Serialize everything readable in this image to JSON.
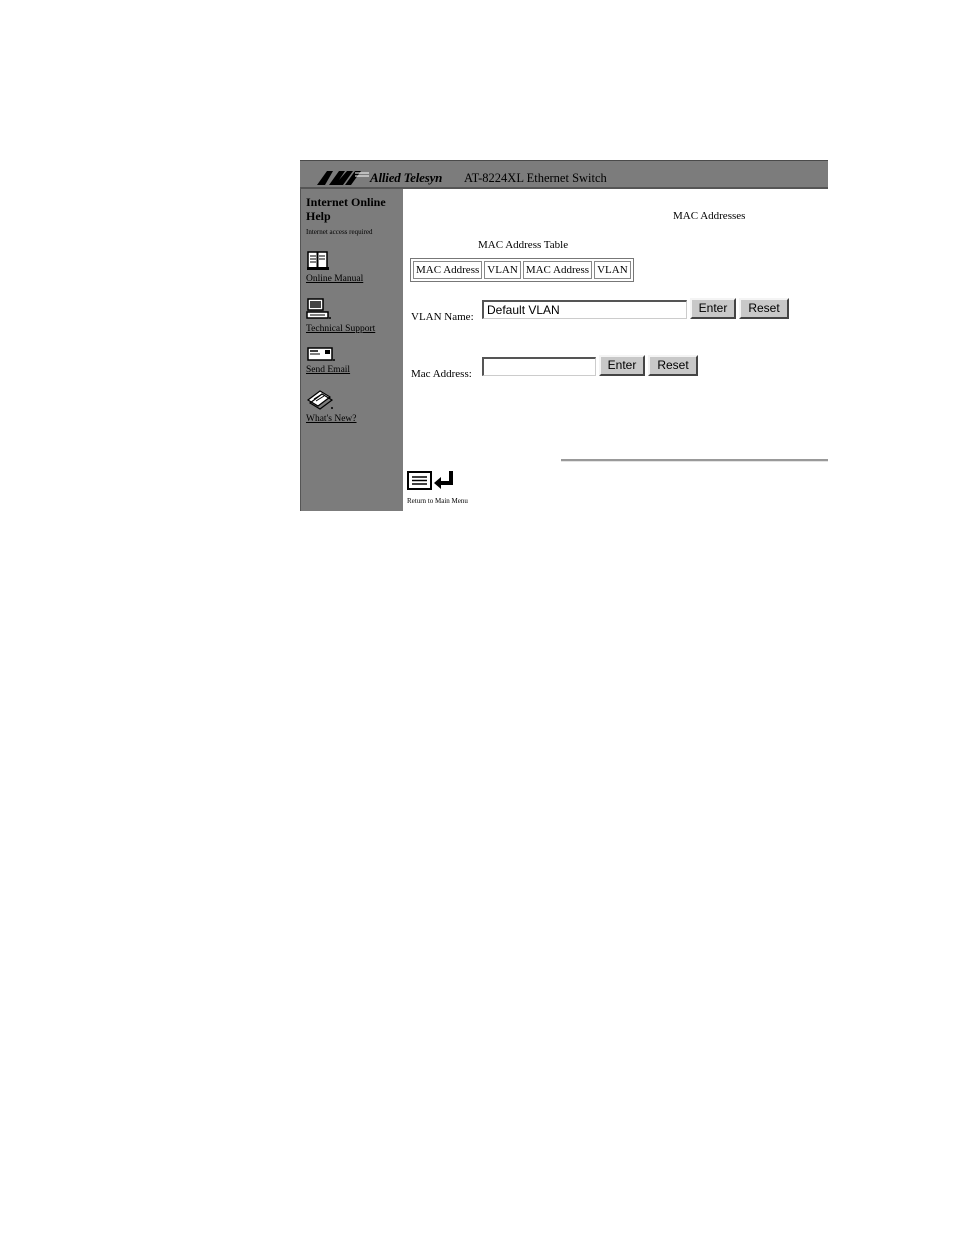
{
  "header": {
    "brand": "Allied Telesyn",
    "product": "AT-8224XL Ethernet Switch"
  },
  "sidebar": {
    "title": "Internet Online Help",
    "note": "Internet access required",
    "links": [
      {
        "label": "Online Manual",
        "icon": "book-icon"
      },
      {
        "label": "Technical Support",
        "icon": "computer-icon"
      },
      {
        "label": "Send Email",
        "icon": "envelope-icon"
      },
      {
        "label": "What's New?",
        "icon": "pages-icon"
      }
    ]
  },
  "main": {
    "heading": "MAC Addresses",
    "table_caption": "MAC Address Table",
    "table_headers": [
      "MAC Address",
      "VLAN",
      "MAC Address",
      "VLAN"
    ],
    "vlan_label": "VLAN Name:",
    "vlan_value": "Default VLAN",
    "mac_label": "Mac Address:",
    "mac_value": "",
    "enter_label": "Enter",
    "reset_label": "Reset",
    "return_label": "Return to Main Menu"
  }
}
